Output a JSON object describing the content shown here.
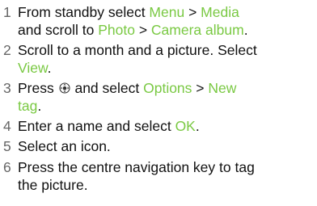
{
  "steps": [
    {
      "number": "1",
      "line1": {
        "t1": "From standby select ",
        "h1": "Menu",
        "t2": " > ",
        "h2": "Media"
      },
      "line2": {
        "t1": "and scroll to ",
        "h1": "Photo",
        "t2": " > ",
        "h2": "Camera album",
        "t3": "."
      }
    },
    {
      "number": "2",
      "line1": {
        "t1": "Scroll to a month and a picture. Select"
      },
      "line2": {
        "h1": "View",
        "t1": "."
      }
    },
    {
      "number": "3",
      "line1": {
        "t1": "Press ",
        "icon": "navigation-key-icon",
        "t2": " and select ",
        "h1": "Options",
        "t3": " > ",
        "h2": "New"
      },
      "line2": {
        "h1": "tag",
        "t1": "."
      }
    },
    {
      "number": "4",
      "line1": {
        "t1": "Enter a name and select ",
        "h1": "OK",
        "t2": "."
      }
    },
    {
      "number": "5",
      "line1": {
        "t1": "Select an icon."
      }
    },
    {
      "number": "6",
      "line1": {
        "t1": "Press the centre navigation key to tag"
      },
      "line2": {
        "t1": "the picture."
      }
    }
  ],
  "colors": {
    "highlight": "#7ac943",
    "number": "#666666",
    "text": "#111111"
  }
}
